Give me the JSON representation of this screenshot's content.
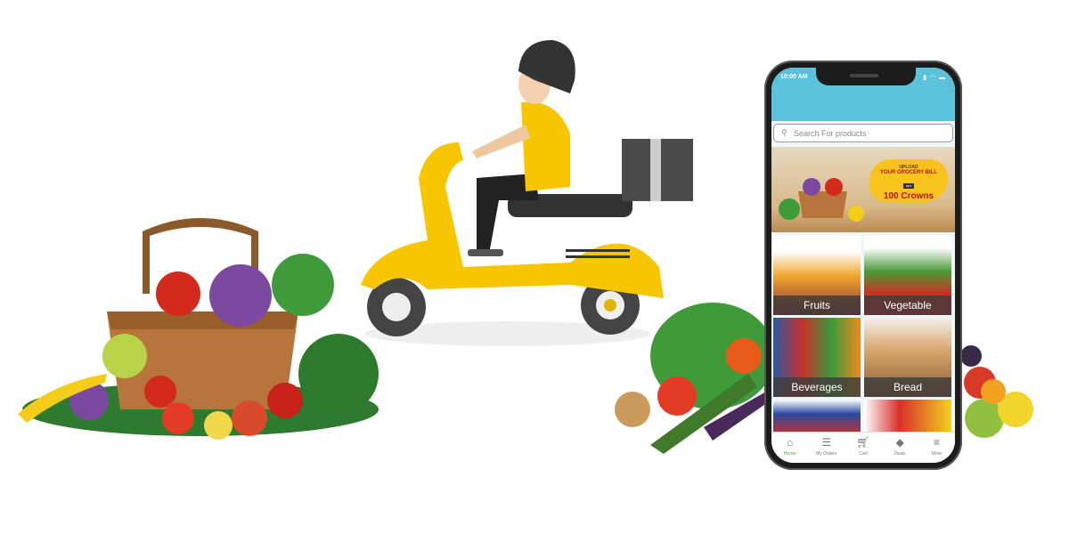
{
  "phone": {
    "status_time": "10:00 AM",
    "search_placeholder": "Search For products",
    "banner": {
      "line1": "UPLOAD",
      "line2": "YOUR GROCERY BILL",
      "line3": "GET",
      "line4": "100 Crowns"
    },
    "categories": [
      {
        "label": "Fruits"
      },
      {
        "label": "Vegetable"
      },
      {
        "label": "Beverages"
      },
      {
        "label": "Bread"
      }
    ],
    "nav": [
      {
        "label": "Home",
        "icon": "home-icon"
      },
      {
        "label": "My Orders",
        "icon": "list-icon"
      },
      {
        "label": "Cart",
        "icon": "cart-icon"
      },
      {
        "label": "Deals",
        "icon": "tag-icon"
      },
      {
        "label": "More",
        "icon": "menu-icon"
      }
    ],
    "accent": "#5bc2dc",
    "active_color": "#3ab34a"
  }
}
